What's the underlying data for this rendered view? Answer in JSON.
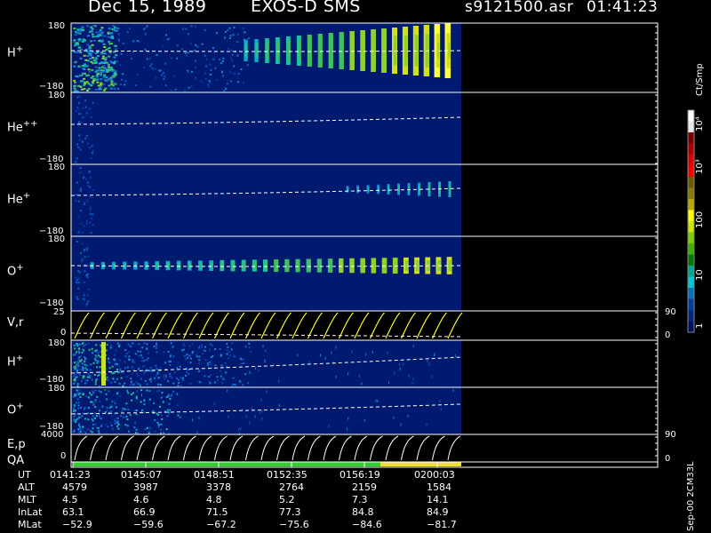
{
  "header": {
    "date": "Dec 15, 1989",
    "instrument": "EXOS-D SMS",
    "file": "s9121500.asr",
    "time": "01:41:23"
  },
  "panels": [
    {
      "id": "h-plus",
      "label": "H",
      "sup": "+",
      "ymax": "180",
      "ymin": "−180"
    },
    {
      "id": "he-plus-plus",
      "label": "He",
      "sup": "++",
      "ymax": "180",
      "ymin": "−180"
    },
    {
      "id": "he-plus",
      "label": "He",
      "sup": "+",
      "ymax": "180",
      "ymin": "−180"
    },
    {
      "id": "o-plus",
      "label": "O",
      "sup": "+",
      "ymax": "180",
      "ymin": "−180"
    },
    {
      "id": "v-r",
      "label": "V,r",
      "sup": "",
      "ymax": "25",
      "ymin": "0",
      "rmax": "90",
      "rmin": "0"
    },
    {
      "id": "h-plus-2",
      "label": "H",
      "sup": "+",
      "ymax": "180",
      "ymin": "−180"
    },
    {
      "id": "o-plus-2",
      "label": "O",
      "sup": "+",
      "ymax": "180",
      "ymin": "−180"
    },
    {
      "id": "e-p",
      "label": "E,p",
      "sup": "",
      "ymax": "4000",
      "ymin": "0",
      "rmax": "90",
      "rmin": "0"
    }
  ],
  "qa_label": "QA",
  "colorbar": {
    "unit": "Ct/Smp",
    "ticks": [
      "10⁴",
      "10³",
      "100",
      "10",
      "1"
    ],
    "colors": [
      "#ffffff",
      "#e8e8e8",
      "#7a0000",
      "#b00000",
      "#e00000",
      "#ff0000",
      "#6b5a00",
      "#8a7a00",
      "#b8a800",
      "#ffff00",
      "#c8e800",
      "#7cd000",
      "#3fb000",
      "#007a00",
      "#00a890",
      "#00c8d8",
      "#0070c0",
      "#003fa0",
      "#002a80",
      "#001060"
    ]
  },
  "footer": {
    "rows": [
      {
        "label": "UT",
        "values": [
          "0141:23",
          "0145:07",
          "0148:51",
          "0152:35",
          "0156:19",
          "0200:03"
        ]
      },
      {
        "label": "ALT",
        "values": [
          "4579",
          "3987",
          "3378",
          "2764",
          "2159",
          "1584"
        ]
      },
      {
        "label": "MLT",
        "values": [
          "4.5",
          "4.6",
          "4.8",
          "5.2",
          "7.3",
          "14.1"
        ]
      },
      {
        "label": "InLat",
        "values": [
          "63.1",
          "66.9",
          "71.5",
          "77.3",
          "84.8",
          "84.9"
        ]
      },
      {
        "label": "MLat",
        "values": [
          "−52.9",
          "−59.6",
          "−67.2",
          "−75.6",
          "−84.6",
          "−81.7"
        ]
      }
    ],
    "side_note": "Sep-00 2CM33L"
  },
  "chart_data": {
    "type": "heatmap",
    "title": "Dec 15, 1989   EXOS-D SMS",
    "x_ticks": [
      "0141:23",
      "0145:07",
      "0148:51",
      "0152:35",
      "0156:19",
      "0200:03"
    ],
    "series": [
      {
        "name": "H+",
        "ylim": [
          -180,
          180
        ]
      },
      {
        "name": "He++",
        "ylim": [
          -180,
          180
        ]
      },
      {
        "name": "He+",
        "ylim": [
          -180,
          180
        ]
      },
      {
        "name": "O+",
        "ylim": [
          -180,
          180
        ]
      },
      {
        "name": "V,r",
        "ylim": [
          0,
          25
        ],
        "right_ylim": [
          0,
          90
        ]
      },
      {
        "name": "H+",
        "ylim": [
          -180,
          180
        ]
      },
      {
        "name": "O+",
        "ylim": [
          -180,
          180
        ]
      },
      {
        "name": "E,p",
        "ylim": [
          0,
          4000
        ],
        "right_ylim": [
          0,
          90
        ]
      }
    ],
    "colorbar_unit": "Ct/Smp",
    "colorbar_ticks": [
      "1",
      "10",
      "100",
      "10³",
      "10⁴"
    ]
  }
}
